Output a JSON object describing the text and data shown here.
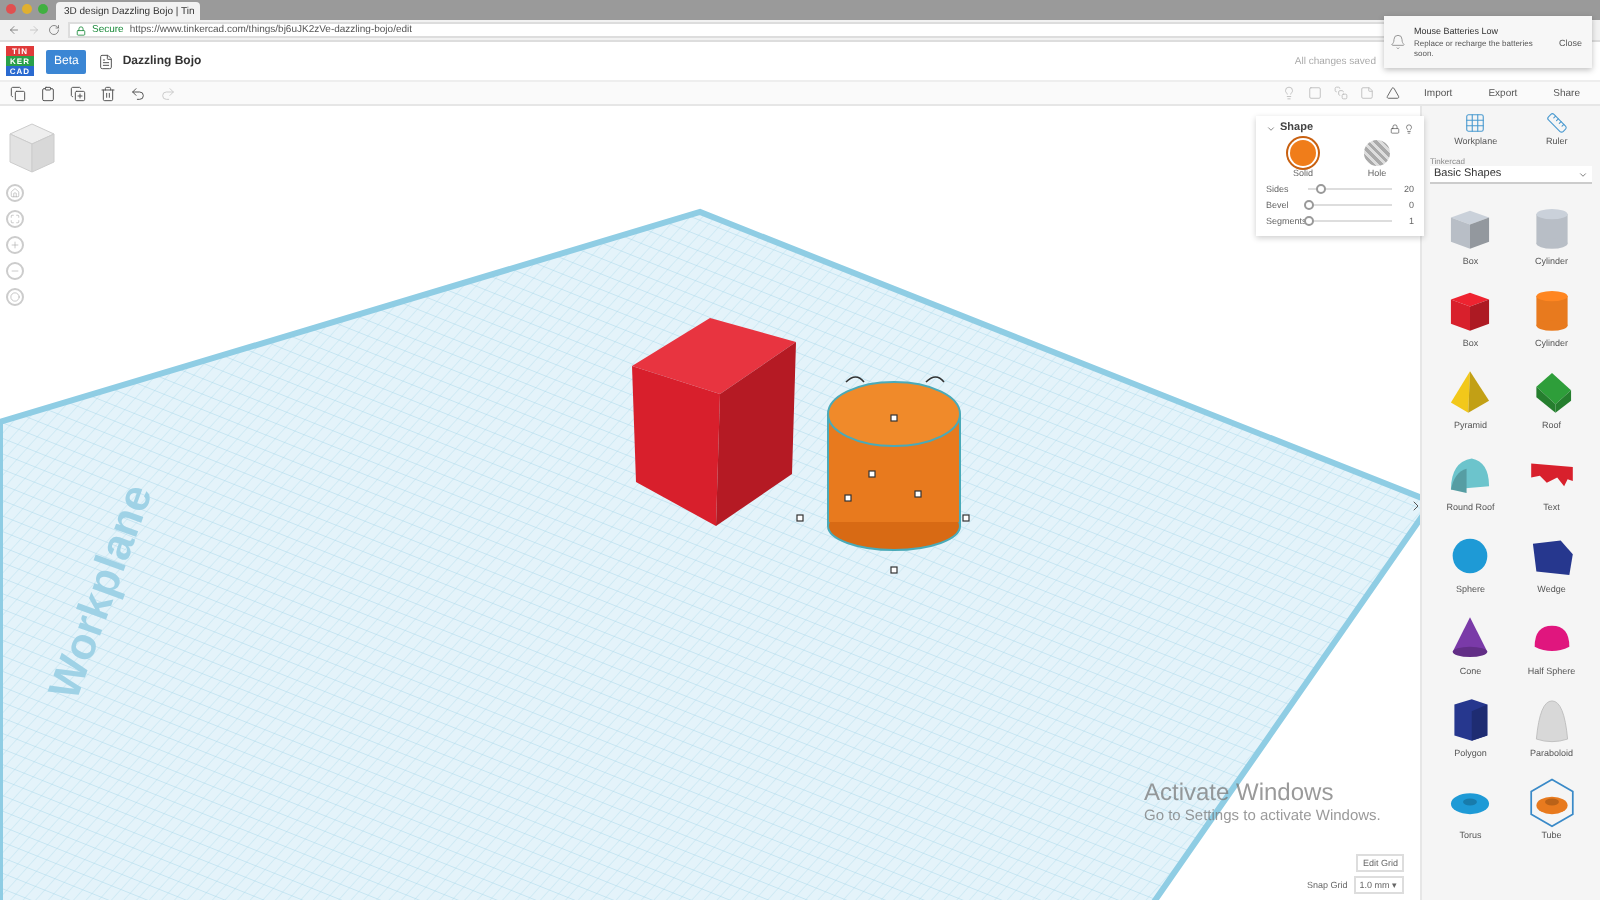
{
  "browser": {
    "tab_title": "3D design Dazzling Bojo | Tin",
    "secure_label": "Secure",
    "url": "https://www.tinkercad.com/things/bj6uJK2zVe-dazzling-bojo/edit"
  },
  "header": {
    "logo": [
      "TIN",
      "KER",
      "CAD"
    ],
    "beta": "Beta",
    "design_name": "Dazzling Bojo",
    "save_status": "All changes saved"
  },
  "notification": {
    "title": "Mouse Batteries Low",
    "message": "Replace or recharge the batteries soon.",
    "action": "Close"
  },
  "toolbar": {
    "tools": [
      {
        "kind": "copy",
        "disabled": false
      },
      {
        "kind": "paste",
        "disabled": false
      },
      {
        "kind": "duplicate",
        "disabled": false
      },
      {
        "kind": "delete",
        "disabled": false
      },
      {
        "kind": "undo",
        "disabled": false
      },
      {
        "kind": "redo",
        "disabled": true
      }
    ],
    "actions": [
      "Import",
      "Export",
      "Share"
    ]
  },
  "canvas": {
    "workplane_label": "Workplane"
  },
  "inspector": {
    "title": "Shape",
    "fills": [
      {
        "label": "Solid",
        "kind": "solid",
        "selected": true
      },
      {
        "label": "Hole",
        "kind": "hole",
        "selected": false
      }
    ],
    "params": [
      {
        "label": "Sides",
        "level": 0.15,
        "reading": "20"
      },
      {
        "label": "Bevel",
        "level": 0,
        "reading": "0"
      },
      {
        "label": "Segments",
        "level": 0,
        "reading": "1"
      }
    ]
  },
  "library": {
    "views": [
      {
        "label": "Workplane",
        "kind": "workplane"
      },
      {
        "label": "Ruler",
        "kind": "ruler"
      }
    ],
    "source": "Tinkercad",
    "category": "Basic Shapes",
    "shapes": [
      {
        "label": "Box",
        "kind": "box",
        "color": "#b8bec6"
      },
      {
        "label": "Cylinder",
        "kind": "cylinder",
        "color": "#b8bec6"
      },
      {
        "label": "Box",
        "kind": "box",
        "color": "#d8202c"
      },
      {
        "label": "Cylinder",
        "kind": "cylinder",
        "color": "#e87a1e"
      },
      {
        "label": "Pyramid",
        "kind": "pyramid",
        "color": "#f2c81a"
      },
      {
        "label": "Roof",
        "kind": "roof",
        "color": "#2e9e3a"
      },
      {
        "label": "Round Roof",
        "kind": "roundroof",
        "color": "#6cc4cc"
      },
      {
        "label": "Text",
        "kind": "text",
        "color": "#d8202c"
      },
      {
        "label": "Sphere",
        "kind": "sphere",
        "color": "#1e9ad6"
      },
      {
        "label": "Wedge",
        "kind": "wedge",
        "color": "#26378e"
      },
      {
        "label": "Cone",
        "kind": "cone",
        "color": "#7a3aa8"
      },
      {
        "label": "Half Sphere",
        "kind": "halfsphere",
        "color": "#e0167e"
      },
      {
        "label": "Polygon",
        "kind": "polygon",
        "color": "#26378e"
      },
      {
        "label": "Paraboloid",
        "kind": "paraboloid",
        "color": "#d8d8d8"
      },
      {
        "label": "Torus",
        "kind": "torus",
        "color": "#1e9ad6"
      },
      {
        "label": "Tube",
        "kind": "tube",
        "color": "#e87a1e"
      }
    ]
  },
  "grid": {
    "edit_label": "Edit Grid",
    "snap_label": "Snap Grid",
    "snap_value": "1.0 mm ▾"
  },
  "os_notice": {
    "title": "Activate Windows",
    "message": "Go to Settings to activate Windows."
  }
}
